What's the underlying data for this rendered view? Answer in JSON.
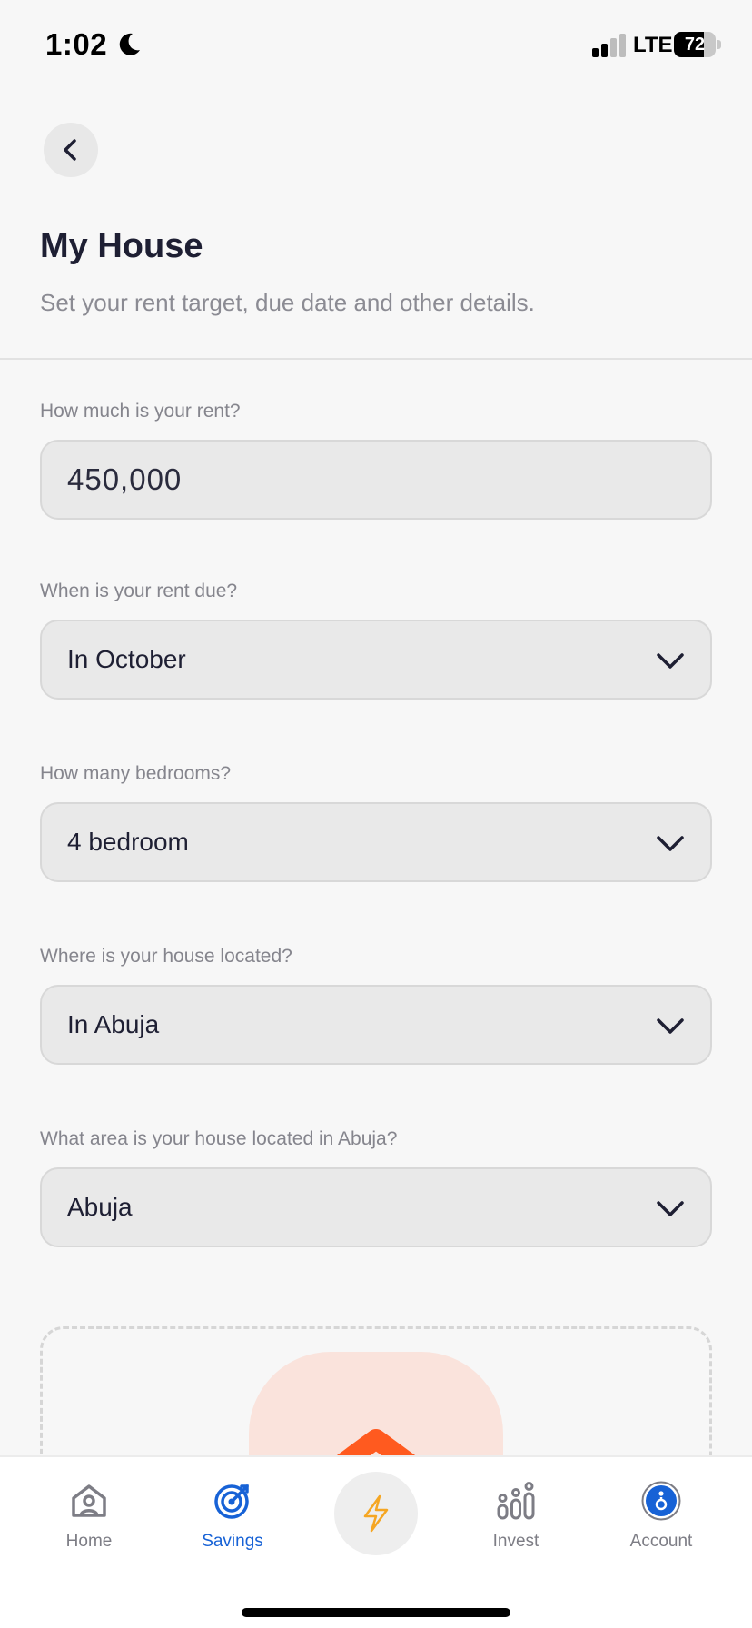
{
  "status_bar": {
    "time": "1:02",
    "network": "LTE",
    "battery_level": 72,
    "battery_label": "72"
  },
  "header": {
    "title": "My House",
    "subtitle": "Set your rent target, due date and other details."
  },
  "form": {
    "rent": {
      "label": "How much is your rent?",
      "value": "450,000"
    },
    "due": {
      "label": "When is your rent due?",
      "value": "In October"
    },
    "bedrooms": {
      "label": "How many bedrooms?",
      "value": "4 bedroom"
    },
    "location": {
      "label": "Where is your house located?",
      "value": "In Abuja"
    },
    "area": {
      "label": "What area is your house located in Abuja?",
      "value": "Abuja"
    }
  },
  "tab_bar": {
    "tabs": [
      {
        "label": "Home",
        "icon": "house-user-icon",
        "active": false
      },
      {
        "label": "Savings",
        "icon": "target-icon",
        "active": true
      },
      {
        "label": "Invest",
        "icon": "bar-chart-icon",
        "active": false
      },
      {
        "label": "Account",
        "icon": "account-icon",
        "active": false
      }
    ],
    "quick_action_icon": "lightning-icon"
  },
  "colors": {
    "accent": "#1762d6",
    "background": "#f7f7f7",
    "field_background": "#e9e9e9",
    "illustration_bg": "#fae3dc",
    "illustration_accent": "#ff5a1f",
    "lightning": "#f5a623"
  }
}
